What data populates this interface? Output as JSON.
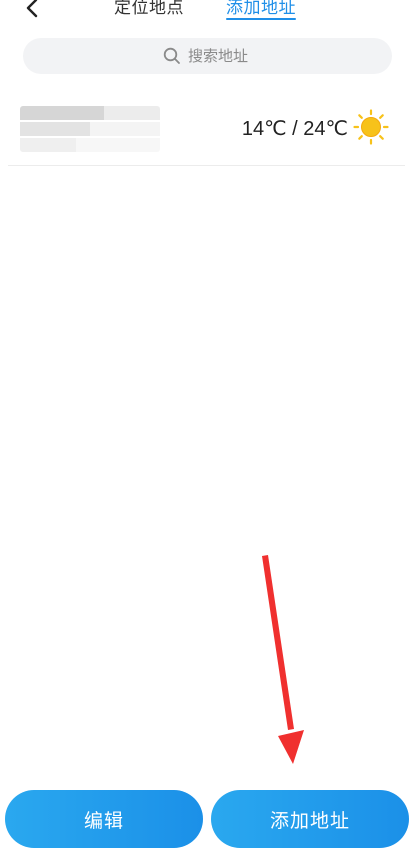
{
  "header": {
    "tabs": [
      {
        "label": "定位地点",
        "active": false
      },
      {
        "label": "添加地址",
        "active": true
      }
    ]
  },
  "search": {
    "placeholder": "搜索地址"
  },
  "cities": [
    {
      "name": "",
      "temp_range": "14℃ / 24℃",
      "weather_icon": "sun-icon"
    }
  ],
  "footer": {
    "edit_label": "编辑",
    "add_label": "添加地址"
  },
  "colors": {
    "accent": "#1f8fe8",
    "button_gradient_start": "#2aa8ef",
    "button_gradient_end": "#1b90e8",
    "search_bg": "#f2f3f5",
    "sun": "#f7c21a",
    "annotation_arrow": "#f0302f"
  }
}
